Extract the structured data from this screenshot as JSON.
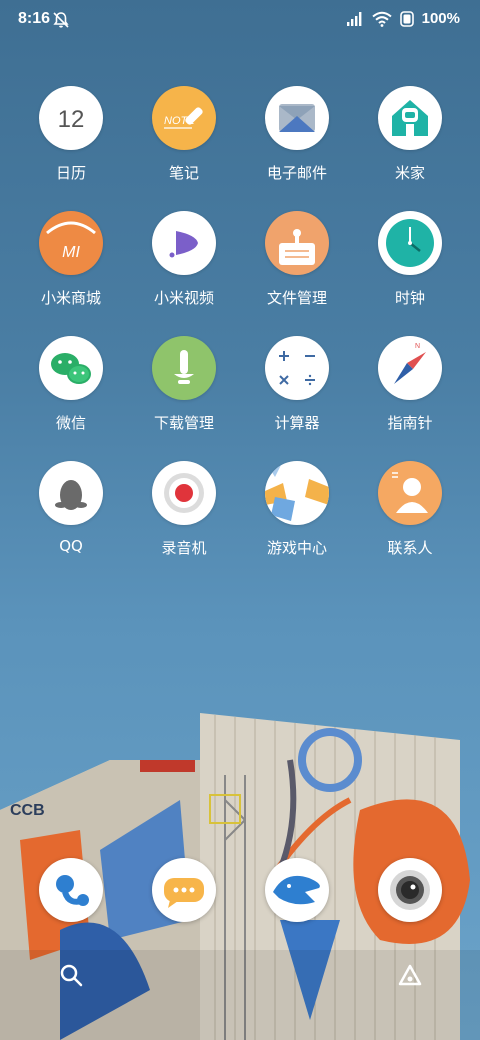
{
  "status_bar": {
    "time": "8:16",
    "battery": "100%"
  },
  "apps": [
    {
      "label": "日历",
      "icon": "calendar-icon",
      "date": "12"
    },
    {
      "label": "笔记",
      "icon": "notes-icon",
      "text": "NOTE"
    },
    {
      "label": "电子邮件",
      "icon": "email-icon"
    },
    {
      "label": "米家",
      "icon": "mijia-icon"
    },
    {
      "label": "小米商城",
      "icon": "mi-store-icon",
      "text": "MI"
    },
    {
      "label": "小米视频",
      "icon": "video-icon"
    },
    {
      "label": "文件管理",
      "icon": "file-manager-icon"
    },
    {
      "label": "时钟",
      "icon": "clock-icon"
    },
    {
      "label": "微信",
      "icon": "wechat-icon"
    },
    {
      "label": "下载管理",
      "icon": "download-icon"
    },
    {
      "label": "计算器",
      "icon": "calculator-icon"
    },
    {
      "label": "指南针",
      "icon": "compass-icon",
      "text": "N"
    },
    {
      "label": "QQ",
      "icon": "qq-icon"
    },
    {
      "label": "录音机",
      "icon": "recorder-icon"
    },
    {
      "label": "游戏中心",
      "icon": "game-center-icon"
    },
    {
      "label": "联系人",
      "icon": "contacts-icon"
    }
  ],
  "mural": {
    "sign": "CCB"
  },
  "dock": [
    {
      "icon": "phone-icon"
    },
    {
      "icon": "messages-icon"
    },
    {
      "icon": "browser-icon"
    },
    {
      "icon": "camera-icon"
    }
  ],
  "bottom": [
    {
      "icon": "search-icon"
    },
    {
      "icon": "app-vault-icon"
    }
  ],
  "colors": {
    "wallpaper_top": "#3f6f93",
    "wallpaper_bottom": "#6ba3c9",
    "accent_orange": "#ee8a44",
    "accent_teal": "#1fb3a6"
  }
}
